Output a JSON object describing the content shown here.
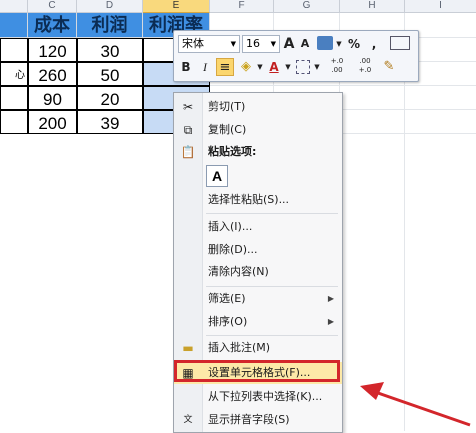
{
  "columns": {
    "C": "C",
    "D": "D",
    "E": "E",
    "F": "F",
    "G": "G",
    "H": "H",
    "I": "I"
  },
  "table": {
    "headers": [
      "成本",
      "利润",
      "利润率"
    ],
    "rows": [
      [
        "120",
        "30"
      ],
      [
        "260",
        "50"
      ],
      [
        "90",
        "20"
      ],
      [
        "200",
        "39"
      ]
    ],
    "left_fragment": "心"
  },
  "mini_toolbar": {
    "font": "宋体",
    "size": "16",
    "bold": "B",
    "italic": "I",
    "align": "≡",
    "font_color": "A",
    "percent": "%",
    "comma": ",",
    "grow_font": "A",
    "shrink_font": "A",
    "dec_increase": "+.0\n.00",
    "dec_decrease": ".00\n+.0"
  },
  "menu": {
    "cut": "剪切(T)",
    "copy": "复制(C)",
    "paste_options": "粘贴选项:",
    "paste_a": "A",
    "paste_special": "选择性粘贴(S)...",
    "insert": "插入(I)...",
    "delete": "删除(D)...",
    "clear": "清除内容(N)",
    "filter": "筛选(E)",
    "sort": "排序(O)",
    "insert_comment": "插入批注(M)",
    "format_cells": "设置单元格格式(F)...",
    "pick_from_list": "从下拉列表中选择(K)...",
    "show_phonetic": "显示拼音字段(S)"
  },
  "icons": {
    "cut": "scissors-icon",
    "copy": "copy-icon",
    "paste": "paste-icon",
    "comment": "comment-icon",
    "format": "format-cells-icon",
    "phonetic": "phonetic-icon"
  },
  "colors": {
    "header_fill": "#3f8fe2",
    "highlight": "#fde9a8",
    "annotation": "#d3262b"
  }
}
